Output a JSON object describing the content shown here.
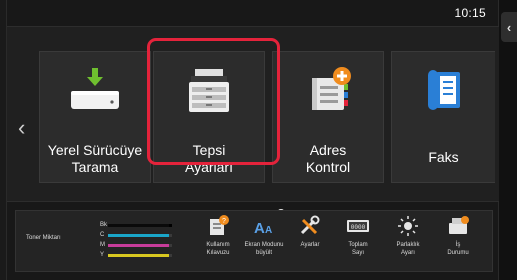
{
  "header": {
    "clock": "10:15",
    "side_tab_glyph": "‹"
  },
  "carousel": {
    "prev_glyph": "‹",
    "tiles": [
      {
        "label": "Yerel Sürücüye\nTarama",
        "icon": "usb-scan-icon"
      },
      {
        "label": "Tepsi\nAyarları",
        "icon": "printer-tray-icon",
        "selected": true
      },
      {
        "label": "Adres\nKontrol",
        "icon": "address-book-add-icon"
      },
      {
        "label": "Faks",
        "icon": "fax-phone-icon"
      }
    ],
    "page_count": 4,
    "active_page": 4
  },
  "toner": {
    "title": "Toner Miktarı",
    "rows": [
      {
        "letter": "Bk",
        "color": "#111111",
        "level": 0.95
      },
      {
        "letter": "C",
        "color": "#1aa6c9",
        "level": 0.95
      },
      {
        "letter": "M",
        "color": "#c83c9a",
        "level": 0.95
      },
      {
        "letter": "Y",
        "color": "#d8c820",
        "level": 0.95
      }
    ]
  },
  "quick_buttons": [
    {
      "label": "Kullanım\nKılavuzu",
      "icon": "user-guide-icon"
    },
    {
      "label": "Ekran Modunu\nbüyült",
      "icon": "enlarge-text-icon"
    },
    {
      "label": "Ayarlar",
      "icon": "tools-icon"
    },
    {
      "label": "Toplam\nSayı",
      "icon": "counter-icon"
    },
    {
      "label": "Parlaklık\nAyarı",
      "icon": "brightness-icon"
    },
    {
      "label": "İş\nDurumu",
      "icon": "job-status-icon"
    }
  ],
  "colors": {
    "highlight": "#e4233b",
    "accent_orange": "#f08c1e",
    "accent_blue": "#2a7fd6",
    "accent_green": "#6fbf2f"
  }
}
